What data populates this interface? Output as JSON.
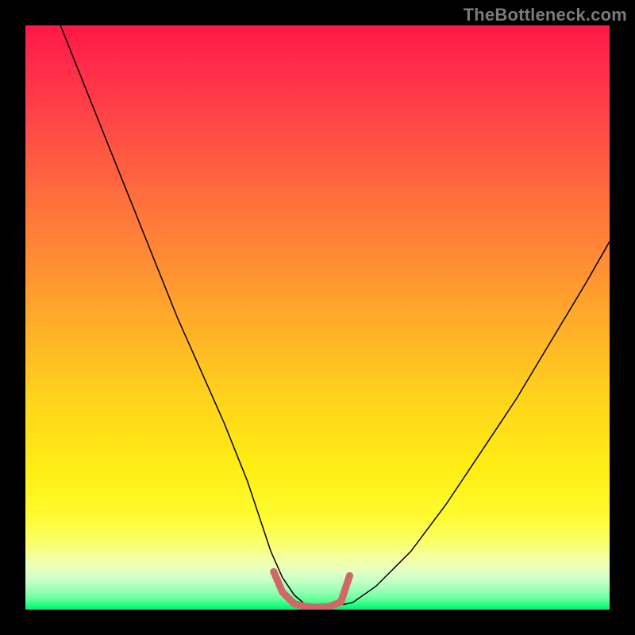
{
  "watermark": {
    "text": "TheBottleneck.com"
  },
  "chart_data": {
    "type": "line",
    "title": "",
    "xlabel": "",
    "ylabel": "",
    "xlim": [
      0,
      100
    ],
    "ylim": [
      0,
      100
    ],
    "grid": false,
    "legend": null,
    "annotations": [],
    "series": [
      {
        "name": "bottleneck-curve",
        "color": "#000000",
        "width": 1.5,
        "x": [
          6,
          10,
          14,
          18,
          22,
          26,
          30,
          34,
          38,
          40,
          42,
          44,
          46,
          48,
          50,
          52,
          56,
          60,
          66,
          72,
          78,
          84,
          90,
          96,
          100
        ],
        "y": [
          100,
          90,
          80,
          70,
          60,
          50,
          41,
          32,
          22,
          16,
          10,
          5.5,
          2.5,
          0.8,
          0.4,
          0.4,
          1.2,
          4,
          10,
          18,
          27,
          36,
          46,
          56,
          63
        ]
      },
      {
        "name": "optimal-zone",
        "color": "#d06868",
        "width": 9,
        "linecap": "round",
        "x": [
          42.5,
          44,
          46,
          48,
          50,
          52,
          54,
          55.5
        ],
        "y": [
          6.5,
          3.0,
          1.0,
          0.5,
          0.4,
          0.5,
          1.3,
          5.8
        ]
      }
    ],
    "background_gradient": {
      "top": "#ff1846",
      "mid": "#ffee14",
      "bottom": "#00f070"
    }
  }
}
